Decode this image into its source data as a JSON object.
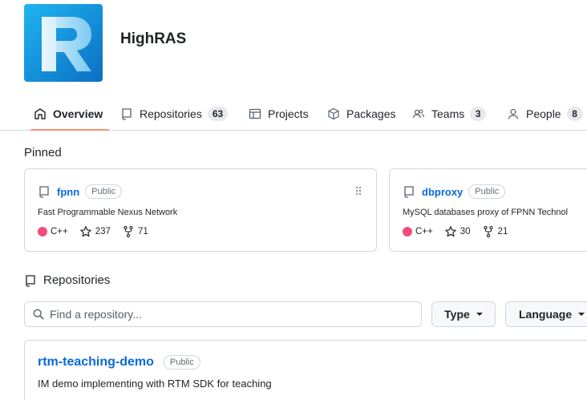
{
  "org": {
    "name": "HighRAS",
    "logo_letter": "R"
  },
  "nav": {
    "items": [
      {
        "label": "Overview",
        "icon": "book-open-icon"
      },
      {
        "label": "Repositories",
        "icon": "repo-icon",
        "count": "63"
      },
      {
        "label": "Projects",
        "icon": "table-icon"
      },
      {
        "label": "Packages",
        "icon": "package-icon"
      },
      {
        "label": "Teams",
        "icon": "people-icon",
        "count": "3"
      },
      {
        "label": "People",
        "icon": "person-icon",
        "count": "8"
      }
    ],
    "selected": "Overview"
  },
  "pinned": {
    "title": "Pinned",
    "cards": [
      {
        "name": "fpnn",
        "visibility": "Public",
        "description": "Fast Programmable Nexus Network",
        "language": "C++",
        "stars": "237",
        "forks": "71"
      },
      {
        "name": "dbproxy",
        "visibility": "Public",
        "description": "MySQL databases proxy of FPNN Technol",
        "language": "C++",
        "stars": "30",
        "forks": "21"
      }
    ]
  },
  "repositories": {
    "title": "Repositories",
    "search_placeholder": "Find a repository...",
    "type_button": "Type",
    "language_button": "Language",
    "items": [
      {
        "name": "rtm-teaching-demo",
        "visibility": "Public",
        "description": "IM demo implementing with RTM SDK for teaching"
      }
    ]
  },
  "colors": {
    "link": "#0969da",
    "cpp_language": "#f34b7d",
    "selected_tab_underline": "#fd8c73",
    "border": "#d0d7de"
  }
}
